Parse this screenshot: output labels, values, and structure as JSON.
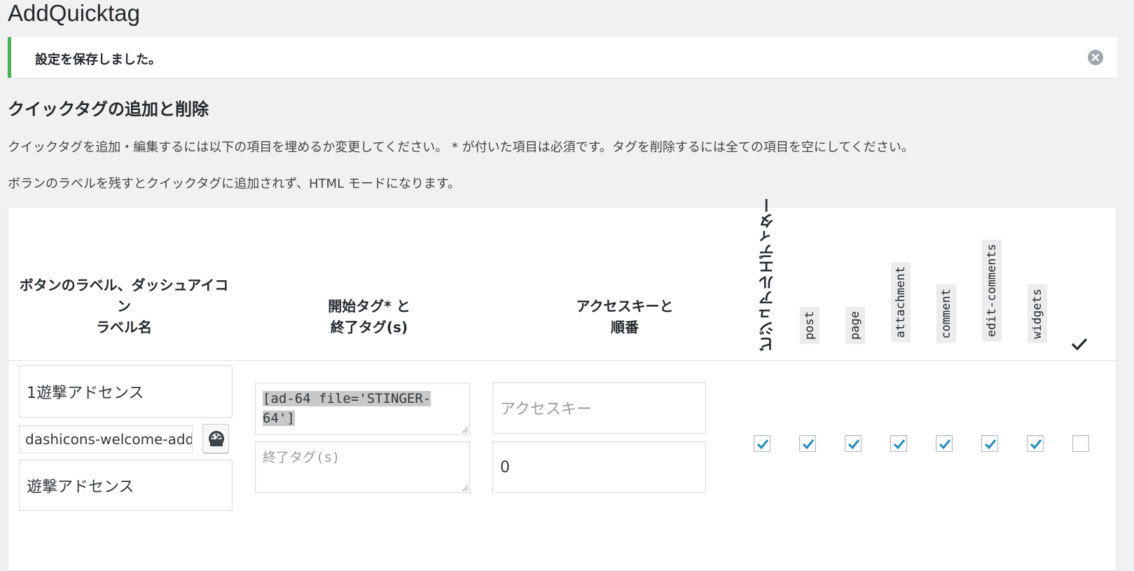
{
  "page": {
    "title": "AddQuicktag"
  },
  "notice": {
    "message": "設定を保存しました。"
  },
  "section": {
    "title": "クイックタグの追加と削除",
    "desc1": "クイックタグを追加・編集するには以下の項目を埋めるか変更してください。 * が付いた項目は必須です。タグを削除するには全ての項目を空にしてください。",
    "desc2": "ボランのラベルを残すとクイックタグに追加されず、HTML モードになります。"
  },
  "table": {
    "headers": {
      "col1_line1": "ボタンのラベル、ダッシュアイコ",
      "col1_line2": "ン",
      "col1_line3": "ラベル名",
      "col2_line1": "開始タグ* と",
      "col2_line2": "終了タグ(s)",
      "col3_line1": "アクセスキーと",
      "col3_line2": "順番",
      "visual_editor": "ビジュアルエディター",
      "post": "post",
      "page": "page",
      "attachment": "attachment",
      "comment": "comment",
      "edit_comments": "edit-comments",
      "widgets": "widgets"
    },
    "row": {
      "button_label": "1遊撃アドセンス",
      "dashicon": "dashicons-welcome-add",
      "label_name": "遊撃アドセンス",
      "start_tag": "[ad-64 file='STINGER-64']",
      "start_tag_line1": "[ad-64 file='STINGER-",
      "start_tag_line2": "64']",
      "end_tag_placeholder": "終了タグ(s)",
      "access_key_placeholder": "アクセスキー",
      "order": "0",
      "checks": {
        "visual_editor": true,
        "post": true,
        "page": true,
        "attachment": true,
        "comment": true,
        "edit_comments": true,
        "widgets": true,
        "all": false
      }
    }
  },
  "colors": {
    "accent": "#46b450",
    "check": "#1e8cbe"
  },
  "icons": [
    "dismiss-icon",
    "dashboard-icon",
    "checkmark-icon"
  ]
}
